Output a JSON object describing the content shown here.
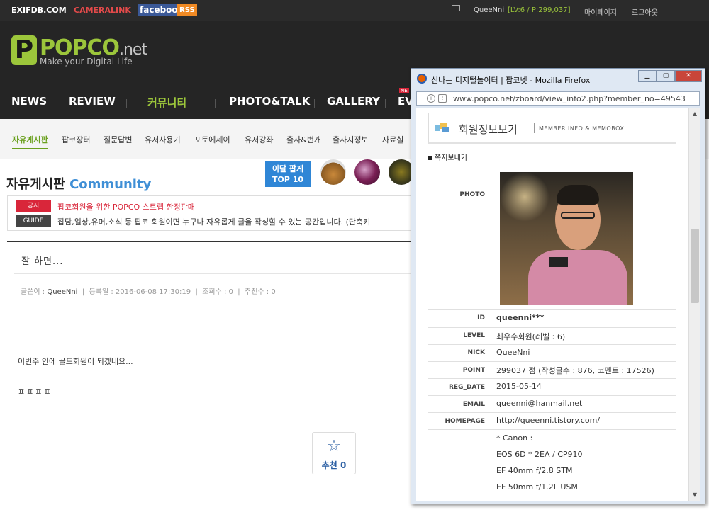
{
  "topbar": {
    "links": [
      "EXIFDB.COM",
      "CAMERALINK",
      "facebook",
      "RSS"
    ],
    "username": "QueeNni",
    "level": "[LV:6 / P:299,037]",
    "mypage": "마이페이지",
    "logout": "로그아웃"
  },
  "logo": {
    "text": "POPCO",
    "domain": ".net",
    "tagline": "Make your Digital Life"
  },
  "gnb": [
    "NEWS",
    "REVIEW",
    "커뮤니티",
    "PHOTO&TALK",
    "GALLERY",
    "EV"
  ],
  "gnb_badge": "NE",
  "subnav": [
    "자유게시판",
    "팝코장터",
    "질문답변",
    "유저사용기",
    "포토에세이",
    "유저강좌",
    "출사&번개",
    "출사지정보",
    "자료실"
  ],
  "board": {
    "title_ko": "자유게시판",
    "title_en": "Community"
  },
  "month_pick": {
    "line1": "이달 팝게",
    "line2": "TOP 10"
  },
  "notice": {
    "badge1": "공지",
    "text1": "팝코회원을 위한 POPCO 스트랩 한정판매",
    "badge2": "GUIDE",
    "text2": "잡담,일상,유머,소식 등 팝코 회원이면 누구나 자유롭게 글을 작성할 수 있는 공간입니다. (단축키"
  },
  "post": {
    "title": "잘 하면...",
    "meta_writer_label": "글쓴이 :",
    "writer": "QueeNni",
    "meta_date": "등록일 : 2016-06-08 17:30:19",
    "meta_views": "조회수 : 0",
    "meta_recommend": "추천수 : 0",
    "body1": "이번주 안에 골드회원이 되겠네요...",
    "body2": "ㅍㅍㅍㅍ",
    "recommend_label": "추천",
    "recommend_count": "0"
  },
  "popup": {
    "window_title": "신나는 디지털놀이터 | 팝코넷 - Mozilla Firefox",
    "url": "www.popco.net/zboard/view_info2.php?member_no=49543",
    "header_ko": "회원정보보기",
    "header_en": "MEMBER INFO & MEMOBOX",
    "send_msg": "쪽지보내기",
    "photo_label": "PHOTO",
    "fields": [
      {
        "label": "ID",
        "value": "queenni***"
      },
      {
        "label": "LEVEL",
        "value": "최우수회원(레벨 : 6)"
      },
      {
        "label": "NICK",
        "value": "QueeNni"
      },
      {
        "label": "POINT",
        "value": "299037 점 (작성글수 : 876, 코멘트 : 17526)"
      },
      {
        "label": "REG_DATE",
        "value": "2015-05-14"
      },
      {
        "label": "EMAIL",
        "value": "queenni@hanmail.net"
      },
      {
        "label": "HOMEPAGE",
        "value": "http://queenni.tistory.com/"
      }
    ],
    "homepage_lines": [
      "* Canon :",
      "EOS 6D * 2EA / CP910",
      "EF 40mm f/2.8 STM",
      "EF 50mm f/1.2L USM"
    ]
  },
  "colors": {
    "accent": "#9cc63b",
    "link_blue": "#3f8fd6",
    "notice_red": "#d9263a"
  }
}
